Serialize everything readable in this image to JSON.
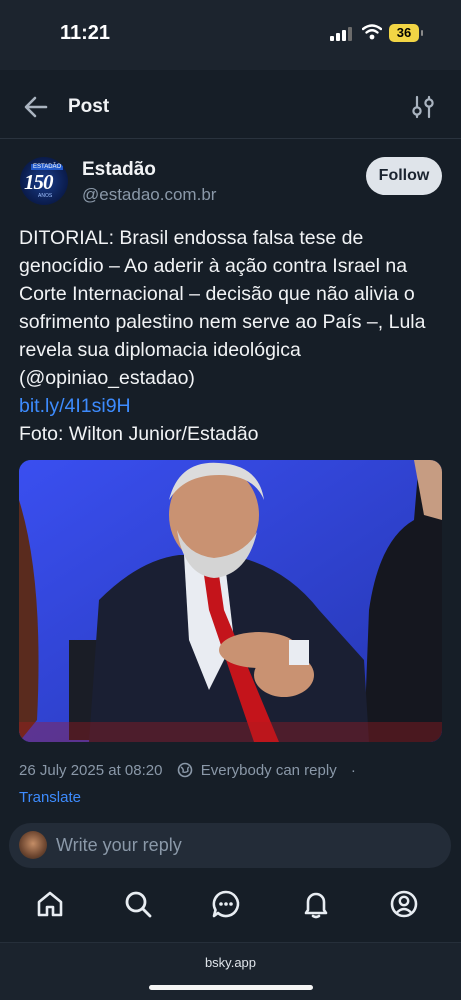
{
  "status_bar": {
    "time": "11:21",
    "battery": "36"
  },
  "header": {
    "title": "Post"
  },
  "author": {
    "avatar_text": "150",
    "avatar_tag": "ESTADÃO",
    "avatar_years": "ANOS",
    "name": "Estadão",
    "handle": "@estadao.com.br",
    "follow_label": "Follow"
  },
  "post": {
    "text_main": "DITORIAL: Brasil endossa falsa tese de genocídio – Ao aderir à ação contra Israel na Corte Internacional – decisão que não alivia o sofrimento palestino nem serve ao País –, Lula revela sua diplomacia ideológica (@opiniao_estadao)",
    "link": "bit.ly/4I1si9H",
    "credit": "Foto: Wilton Junior/Estadão",
    "timestamp": "26 July 2025 at 08:20",
    "reply_setting": "Everybody can reply",
    "separator": "·",
    "translate_label": "Translate"
  },
  "reply": {
    "placeholder": "Write your reply"
  },
  "nav": {
    "items": [
      {
        "icon": "home-icon"
      },
      {
        "icon": "search-icon"
      },
      {
        "icon": "chat-icon"
      },
      {
        "icon": "bell-icon"
      },
      {
        "icon": "profile-icon"
      }
    ]
  },
  "browser": {
    "url": "bsky.app"
  },
  "colors": {
    "background": "#161e27",
    "link": "#3d8bfd",
    "muted": "#8a98a8"
  }
}
